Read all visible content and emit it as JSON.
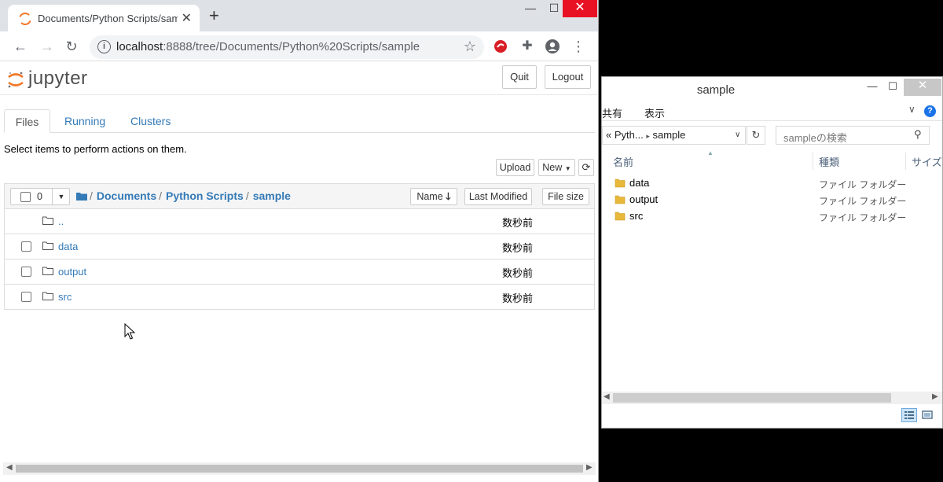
{
  "chrome": {
    "tab_title": "Documents/Python Scripts/sample",
    "url_host": "localhost",
    "url_rest": ":8888/tree/Documents/Python%20Scripts/sample",
    "win_min": "—",
    "win_max": "☐",
    "win_close": "✕"
  },
  "jupyter": {
    "logo_text": "jupyter",
    "quit_label": "Quit",
    "logout_label": "Logout",
    "tabs": [
      "Files",
      "Running",
      "Clusters"
    ],
    "select_message": "Select items to perform actions on them.",
    "upload_label": "Upload",
    "new_label": "New",
    "select_count": "0",
    "breadcrumb": [
      "Documents",
      "Python Scripts",
      "sample"
    ],
    "columns": {
      "name": "Name",
      "last_modified": "Last Modified",
      "file_size": "File size"
    },
    "rows": [
      {
        "name": "..",
        "modified": "数秒前",
        "checkbox": false
      },
      {
        "name": "data",
        "modified": "数秒前",
        "checkbox": true
      },
      {
        "name": "output",
        "modified": "数秒前",
        "checkbox": true
      },
      {
        "name": "src",
        "modified": "数秒前",
        "checkbox": true
      }
    ]
  },
  "explorer": {
    "title": "sample",
    "ribbon": [
      "共有",
      "表示"
    ],
    "address": [
      "Pyth...",
      "sample"
    ],
    "search_placeholder": "sampleの検索",
    "columns": [
      "名前",
      "種類",
      "サイズ"
    ],
    "items": [
      {
        "name": "data",
        "kind": "ファイル フォルダー"
      },
      {
        "name": "output",
        "kind": "ファイル フォルダー"
      },
      {
        "name": "src",
        "kind": "ファイル フォルダー"
      }
    ]
  },
  "colors": {
    "jupyter_link": "#337ab7",
    "jupyter_orange": "#f37726",
    "chrome_close": "#e81123",
    "folder_yellow": "#e8b83a"
  }
}
